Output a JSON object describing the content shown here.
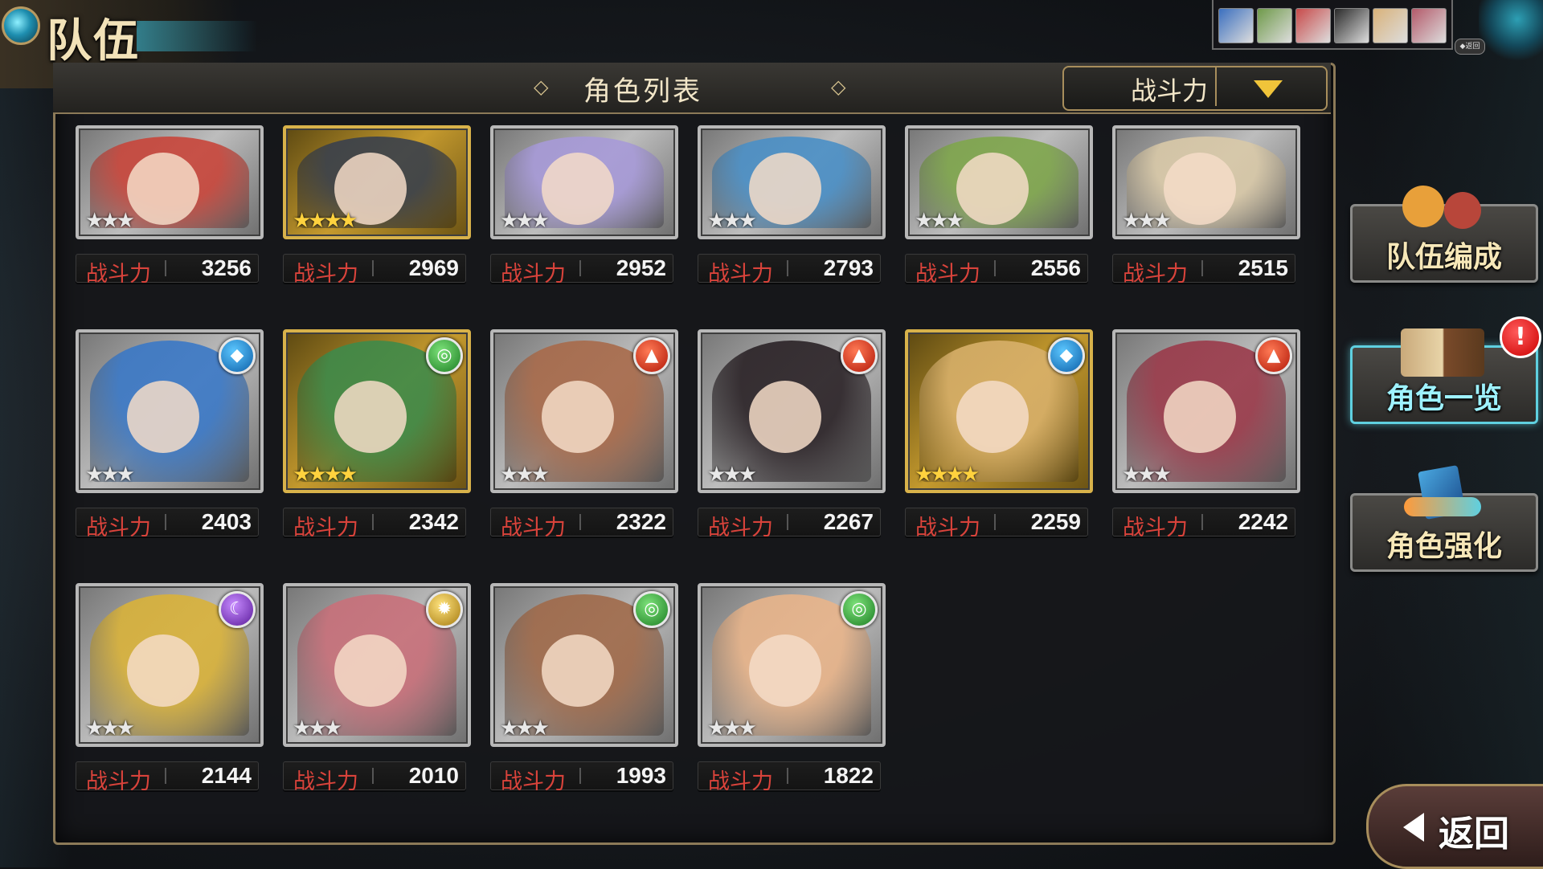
{
  "header": {
    "screen_title": "队伍",
    "list_title": "角色列表",
    "sort_label": "战斗力"
  },
  "party_strip": {
    "badge": "◆返回",
    "thumb_colors": [
      "#3b6fbf",
      "#6f9a4a",
      "#c84a4a",
      "#2a2a2a",
      "#d9b27a",
      "#b45a6a"
    ]
  },
  "characters": [
    {
      "label": "战斗力",
      "power": "3256",
      "rarity": "★★★",
      "frame": "silver",
      "element": "",
      "art_color": "#c8453a"
    },
    {
      "label": "战斗力",
      "power": "2969",
      "rarity": "★★★★",
      "frame": "gold",
      "element": "",
      "art_color": "#39404c"
    },
    {
      "label": "战斗力",
      "power": "2952",
      "rarity": "★★★",
      "frame": "silver",
      "element": "",
      "art_color": "#a79ad8"
    },
    {
      "label": "战斗力",
      "power": "2793",
      "rarity": "★★★",
      "frame": "silver",
      "element": "",
      "art_color": "#4a8fc6"
    },
    {
      "label": "战斗力",
      "power": "2556",
      "rarity": "★★★",
      "frame": "silver",
      "element": "",
      "art_color": "#7fa64c"
    },
    {
      "label": "战斗力",
      "power": "2515",
      "rarity": "★★★",
      "frame": "silver",
      "element": "",
      "art_color": "#d9c9a8"
    },
    {
      "label": "战斗力",
      "power": "2403",
      "rarity": "★★★",
      "frame": "silver",
      "element": "water",
      "art_color": "#3a78c6"
    },
    {
      "label": "战斗力",
      "power": "2342",
      "rarity": "★★★★",
      "frame": "gold",
      "element": "wind",
      "art_color": "#3e8a4a"
    },
    {
      "label": "战斗力",
      "power": "2322",
      "rarity": "★★★",
      "frame": "silver",
      "element": "fire",
      "art_color": "#a86a4a"
    },
    {
      "label": "战斗力",
      "power": "2267",
      "rarity": "★★★",
      "frame": "silver",
      "element": "fire",
      "art_color": "#2a2226"
    },
    {
      "label": "战斗力",
      "power": "2259",
      "rarity": "★★★★",
      "frame": "gold",
      "element": "water",
      "art_color": "#d8b06a"
    },
    {
      "label": "战斗力",
      "power": "2242",
      "rarity": "★★★",
      "frame": "silver",
      "element": "fire",
      "art_color": "#9a3a4a"
    },
    {
      "label": "战斗力",
      "power": "2144",
      "rarity": "★★★",
      "frame": "silver",
      "element": "dark",
      "art_color": "#d9b23a"
    },
    {
      "label": "战斗力",
      "power": "2010",
      "rarity": "★★★",
      "frame": "silver",
      "element": "light",
      "art_color": "#c8707a"
    },
    {
      "label": "战斗力",
      "power": "1993",
      "rarity": "★★★",
      "frame": "silver",
      "element": "wind",
      "art_color": "#a06a4a"
    },
    {
      "label": "战斗力",
      "power": "1822",
      "rarity": "★★★",
      "frame": "silver",
      "element": "wind",
      "art_color": "#e8b48a"
    }
  ],
  "side_menu": {
    "team_edit": "队伍编成",
    "char_list": "角色一览",
    "char_enhance": "角色强化",
    "alert": "!"
  },
  "back": {
    "label": "返回"
  },
  "colors": {
    "power_label": "#d9433b",
    "accent_gold": "#d8b24a",
    "accent_cyan": "#5fd0e0"
  }
}
